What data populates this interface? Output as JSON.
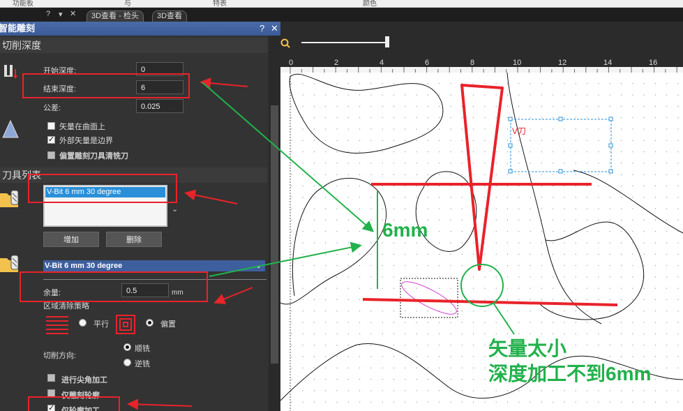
{
  "top_strip": [
    "功能板",
    "与",
    "特表",
    "颜色"
  ],
  "tabs": [
    "3D查看 - 检头",
    "3D查看"
  ],
  "panel": {
    "title": "智能雕刻",
    "help": "?",
    "close": "✕",
    "sections": {
      "cut_depth": "切削深度",
      "tool_list": "刀具列表"
    },
    "start_depth_label": "开始深度:",
    "start_depth_value": "0",
    "end_depth_label": "结束深度:",
    "end_depth_value": "6",
    "tolerance_label": "公差:",
    "tolerance_value": "0.025",
    "vector_on_surface": "矢量在曲面上",
    "outer_vector_boundary": "外部矢量是边界",
    "offset_tool_label": "偏置雕刻刀具清铣刀",
    "tool_item": "V-Bit 6 mm 30 degree",
    "add_button": "增加",
    "delete_button": "删除",
    "tool_dropdown": "V-Bit 6 mm 30 degree",
    "allowance_label": "余量:",
    "allowance_value": "0.5",
    "allowance_unit": "mm",
    "area_clear_label": "区域清除策略",
    "parallel_label": "平行",
    "offset_label": "偏置",
    "cut_direction_label": "切削方向:",
    "climb_label": "顺铣",
    "conventional_label": "逆铣",
    "corner_machining": "进行尖角加工",
    "contour_only_a": "仅雕刻轮廓",
    "contour_only_b": "仅轮廓加工"
  },
  "ruler": [
    "0",
    "2",
    "4",
    "6",
    "8",
    "10",
    "12",
    "14",
    "16"
  ],
  "canvas": {
    "vector_label": "V刀",
    "annotation_depth": "6mm",
    "annotation_line1": "矢量太小",
    "annotation_line2": "深度加工不到6mm"
  },
  "colors": {
    "title_bar": "#3f5f9f",
    "highlight_red": "#e8232a",
    "annotation_green": "#22b14c",
    "selection_blue": "#2a8fd8"
  }
}
